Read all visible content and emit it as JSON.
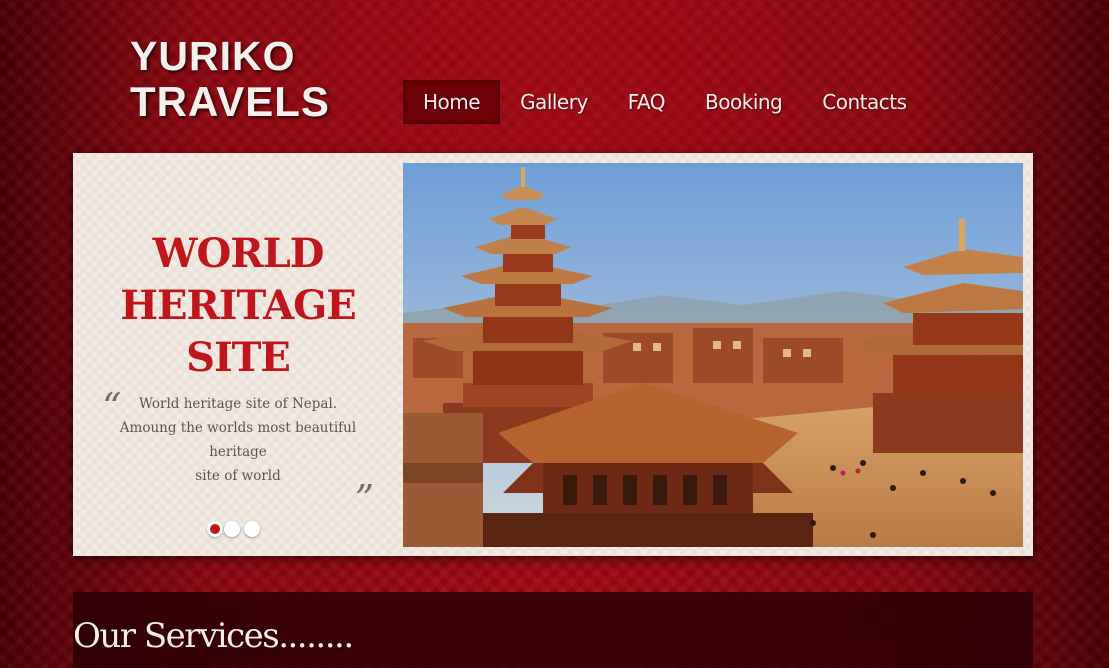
{
  "logo": {
    "line1": "YURIKO",
    "line2": "TRAVELS"
  },
  "nav": {
    "items": [
      {
        "label": "Home",
        "active": true
      },
      {
        "label": "Gallery",
        "active": false
      },
      {
        "label": "FAQ",
        "active": false
      },
      {
        "label": "Booking",
        "active": false
      },
      {
        "label": "Contacts",
        "active": false
      }
    ]
  },
  "slider": {
    "title": "WORLD\nHERITAGE\nSITE",
    "caption": "World heritage site of Nepal.\nAmoung the worlds most beautiful heritage\nsite of world",
    "quote_open": "“",
    "quote_close": "”",
    "dots": [
      true,
      false,
      false
    ],
    "image_icon": "temple-photo"
  },
  "services": {
    "heading": "Our Services........"
  },
  "colors": {
    "accent_red": "#c0161b",
    "nav_active_bg": "#6f0208",
    "panel_bg": "#f3ebe5",
    "services_bg": "#280003"
  }
}
